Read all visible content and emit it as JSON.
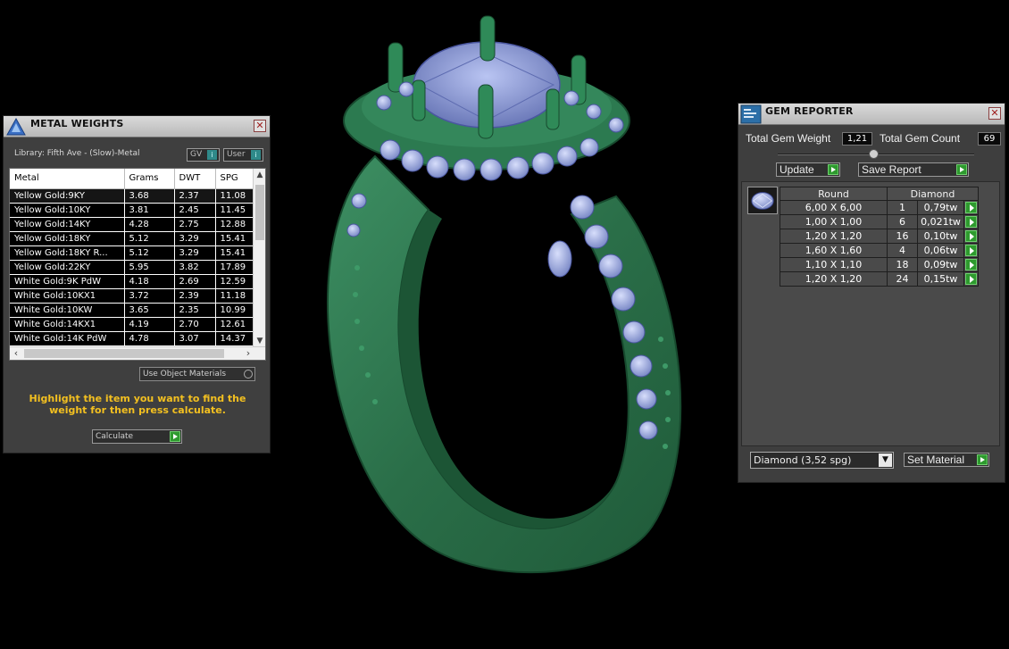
{
  "metal_panel": {
    "title": "METAL WEIGHTS",
    "library_label": "Library: Fifth Ave - (Slow)-Metal",
    "gv_button": "GV",
    "user_button": "User",
    "columns": [
      "Metal",
      "Grams",
      "DWT",
      "SPG"
    ],
    "rows": [
      [
        "Yellow Gold:9KY",
        "3.68",
        "2.37",
        "11.08"
      ],
      [
        "Yellow Gold:10KY",
        "3.81",
        "2.45",
        "11.45"
      ],
      [
        "Yellow Gold:14KY",
        "4.28",
        "2.75",
        "12.88"
      ],
      [
        "Yellow Gold:18KY",
        "5.12",
        "3.29",
        "15.41"
      ],
      [
        "Yellow Gold:18KY R...",
        "5.12",
        "3.29",
        "15.41"
      ],
      [
        "Yellow Gold:22KY",
        "5.95",
        "3.82",
        "17.89"
      ],
      [
        "White Gold:9K PdW",
        "4.18",
        "2.69",
        "12.59"
      ],
      [
        "White Gold:10KX1",
        "3.72",
        "2.39",
        "11.18"
      ],
      [
        "White Gold:10KW",
        "3.65",
        "2.35",
        "10.99"
      ],
      [
        "White Gold:14KX1",
        "4.19",
        "2.70",
        "12.61"
      ],
      [
        "White Gold:14K PdW",
        "4.78",
        "3.07",
        "14.37"
      ]
    ],
    "use_object_materials": "Use Object Materials",
    "hint": "Highlight the item you want to find the weight for then press calculate.",
    "calculate_button": "Calculate",
    "close_glyph": "✕"
  },
  "gem_panel": {
    "title": "GEM REPORTER",
    "total_gem_weight_label": "Total Gem Weight",
    "total_gem_weight_value": "1,21",
    "total_gem_count_label": "Total Gem Count",
    "total_gem_count_value": "69",
    "update_button": "Update",
    "save_report_button": "Save Report",
    "shape_header": "Round",
    "material_header": "Diamond",
    "rows": [
      [
        "6,00 X 6,00",
        "1",
        "0,79tw"
      ],
      [
        "1,00 X 1,00",
        "6",
        "0,021tw"
      ],
      [
        "1,20 X 1,20",
        "16",
        "0,10tw"
      ],
      [
        "1,60 X 1,60",
        "4",
        "0,06tw"
      ],
      [
        "1,10 X 1,10",
        "18",
        "0,09tw"
      ],
      [
        "1,20 X 1,20",
        "24",
        "0,15tw"
      ]
    ],
    "material_select": "Diamond    (3,52 spg)",
    "set_material_button": "Set Material",
    "close_glyph": "✕"
  },
  "colors": {
    "ring_metal": "#2f7a52",
    "gem": "#8e9dd8",
    "panel_bg": "#3f3f3f",
    "hint_text": "#f3c020",
    "go_button": "#2e9a2e"
  }
}
